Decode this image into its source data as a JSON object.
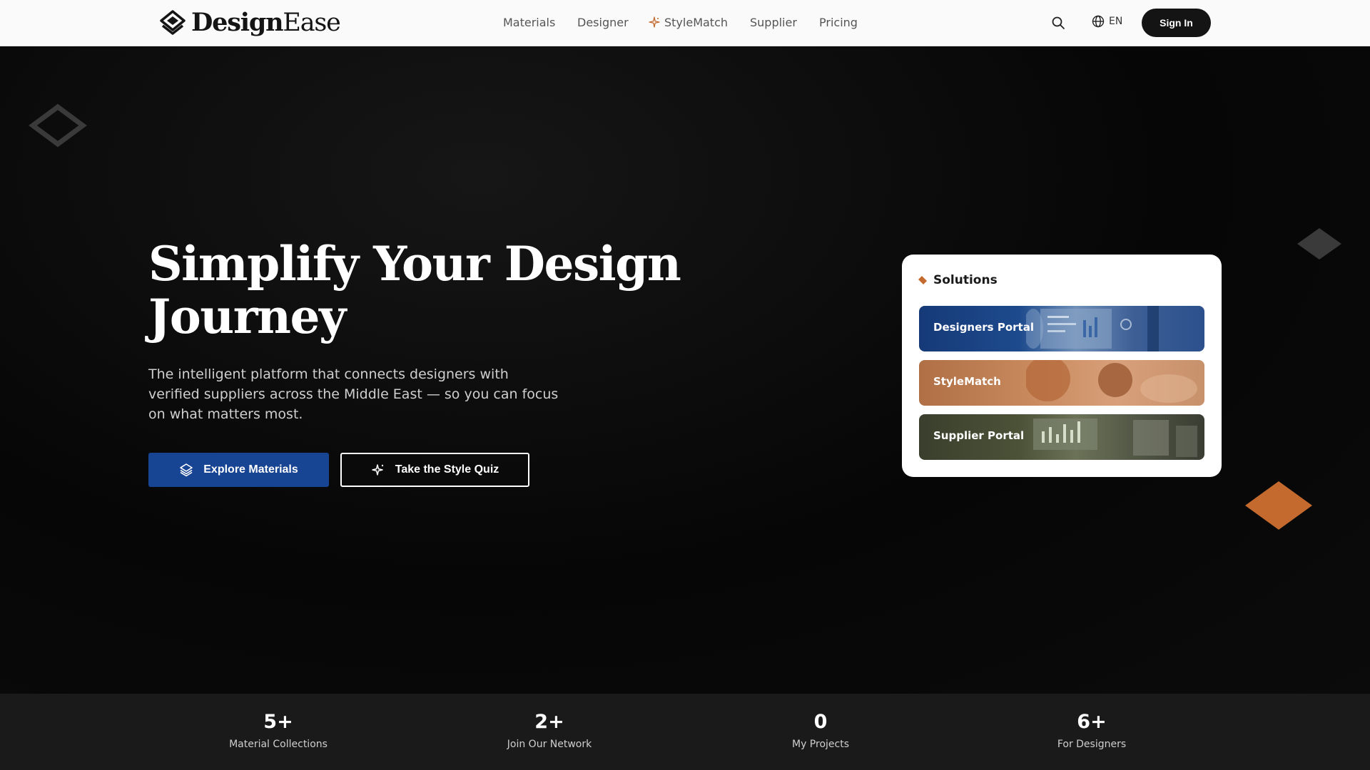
{
  "brand": {
    "name_bold": "Design",
    "name_light": "Ease"
  },
  "nav": {
    "items": [
      {
        "label": "Materials"
      },
      {
        "label": "Designer"
      },
      {
        "label": "StyleMatch"
      },
      {
        "label": "Supplier"
      },
      {
        "label": "Pricing"
      }
    ],
    "language": "EN",
    "signin_label": "Sign In"
  },
  "hero": {
    "title_line1": "Simplify Your Design",
    "title_line2": "Journey",
    "subtitle": "The intelligent platform that connects designers with verified suppliers across the Middle East — so you can focus on what matters most.",
    "primary_cta": "Explore Materials",
    "secondary_cta": "Take the Style Quiz"
  },
  "solutions": {
    "heading": "Solutions",
    "items": [
      {
        "label": "Designers Portal"
      },
      {
        "label": "StyleMatch"
      },
      {
        "label": "Supplier Portal"
      }
    ]
  },
  "stats": [
    {
      "value": "5+",
      "label": "Material Collections"
    },
    {
      "value": "2+",
      "label": "Join Our Network"
    },
    {
      "value": "0",
      "label": "My Projects"
    },
    {
      "value": "6+",
      "label": "For Designers"
    }
  ],
  "colors": {
    "primary": "#184494",
    "accent": "#c46a2e",
    "dark": "#141414"
  },
  "icons": {
    "logo": "layers-diamond-icon",
    "stylematch": "sparkle-icon",
    "search": "search-icon",
    "language": "globe-icon",
    "explore": "layers-icon",
    "quiz": "sparkle-icon"
  }
}
